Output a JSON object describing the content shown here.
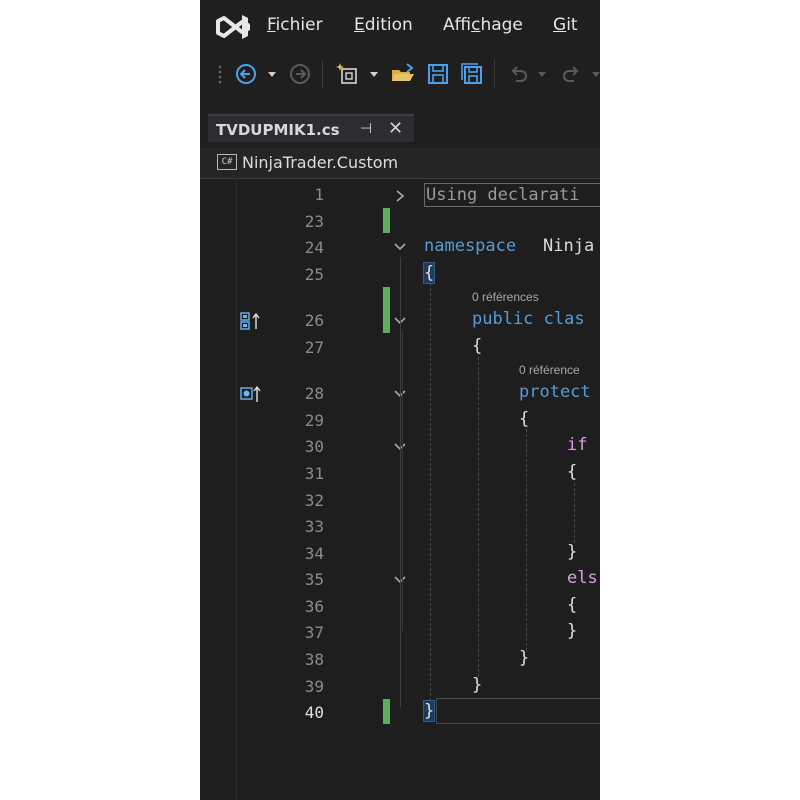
{
  "menu": {
    "items": [
      {
        "mnemonic": "F",
        "rest": "ichier"
      },
      {
        "mnemonic": "E",
        "rest": "dition"
      },
      {
        "before": "Affi",
        "mnemonic": "c",
        "rest": "hage"
      },
      {
        "mnemonic": "G",
        "rest": "it"
      }
    ]
  },
  "toolbar": {
    "icons": [
      "navigate-back-icon",
      "dropdown-arrow-icon",
      "navigate-forward-icon",
      "new-project-icon",
      "open-folder-icon",
      "save-icon",
      "save-all-icon",
      "undo-icon",
      "redo-icon"
    ]
  },
  "tab": {
    "title": "TVDUPMIK1.cs",
    "pin_glyph": "⊣",
    "close_glyph": "✕"
  },
  "navbar": {
    "icon_label": "C#",
    "project": "NinjaTrader.Custom"
  },
  "editor": {
    "line_numbers": [
      "1",
      "23",
      "24",
      "25",
      "26",
      "27",
      "28",
      "29",
      "30",
      "31",
      "32",
      "33",
      "34",
      "35",
      "36",
      "37",
      "38",
      "39",
      "40"
    ],
    "current_line": "40",
    "collapsed_text": "Using declarati",
    "code": {
      "ns_kw": "namespace",
      "ns_name": "Ninja",
      "open_brace": "{",
      "close_brace": "}",
      "refs1": "0 références",
      "class_kw": "public clas",
      "refs2": "0 référence",
      "method_kw": "protect",
      "if_kw": "if",
      "else_kw": "els"
    },
    "colors": {
      "keyword": "#569cd6",
      "control_keyword": "#d8a0df",
      "change_bar": "#5fae5f"
    }
  }
}
